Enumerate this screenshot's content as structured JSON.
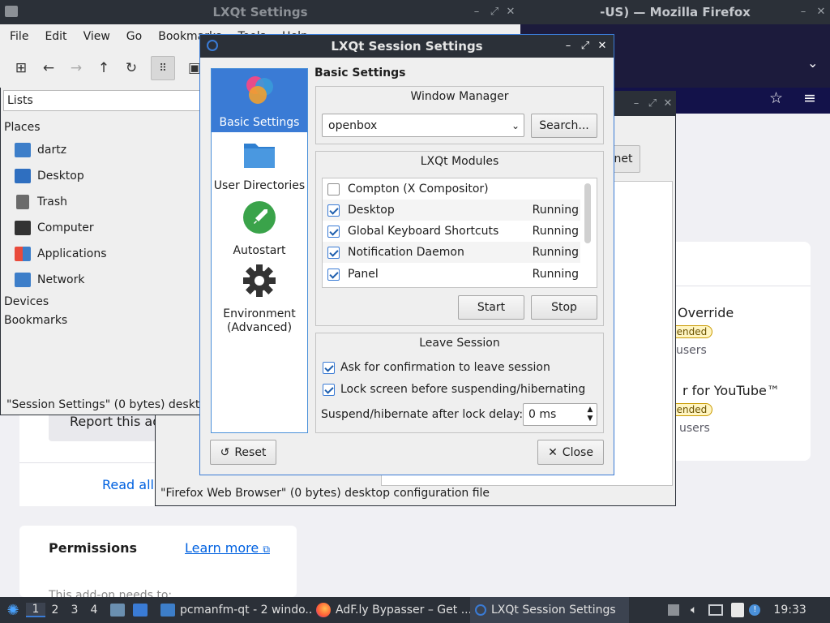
{
  "colors": {
    "accent": "#3a7bd5",
    "titlebar": "#2b3038",
    "window_bg": "#efefef"
  },
  "firefox": {
    "title": "-US) — Mozilla Firefox",
    "content": {
      "tab_fragment": "net",
      "addon1_name": "Override",
      "addon1_badge": "nended",
      "addon1_users": "users",
      "addon2_name": "r for YouTube™",
      "addon2_badge": "nended",
      "addon2_users": "users",
      "report_button": "Report this ad",
      "read_all": "Read all",
      "permissions_title": "Permissions",
      "learn_more": "Learn more",
      "addon_needs": "This add-on needs to:"
    },
    "dialog_status": "\"Firefox Web Browser\" (0 bytes) desktop configuration file"
  },
  "filemanager": {
    "title": "LXQt Settings",
    "menu": [
      "File",
      "Edit",
      "View",
      "Go",
      "Bookmarks",
      "Tools",
      "Help"
    ],
    "sidebar_mode": "Lists",
    "places_header": "Places",
    "places": [
      "dartz",
      "Desktop",
      "Trash",
      "Computer",
      "Applications",
      "Network"
    ],
    "devices_header": "Devices",
    "bookmarks_header": "Bookmarks",
    "status": "\"Session Settings\" (0 bytes) desktop configuration file"
  },
  "dialog": {
    "title": "LXQt Session Settings",
    "nav": [
      {
        "label": "Basic Settings",
        "icon": "lxqt-logo-icon"
      },
      {
        "label": "User Directories",
        "icon": "folder-icon"
      },
      {
        "label": "Autostart",
        "icon": "rocket-icon"
      },
      {
        "label": "Environment (Advanced)",
        "icon": "gear-icon"
      }
    ],
    "section_title": "Basic Settings",
    "window_manager": {
      "title": "Window Manager",
      "value": "openbox",
      "search_label": "Search..."
    },
    "modules": {
      "title": "LXQt Modules",
      "items": [
        {
          "name": "Compton (X Compositor)",
          "checked": false,
          "status": ""
        },
        {
          "name": "Desktop",
          "checked": true,
          "status": "Running"
        },
        {
          "name": "Global Keyboard Shortcuts",
          "checked": true,
          "status": "Running"
        },
        {
          "name": "Notification Daemon",
          "checked": true,
          "status": "Running"
        },
        {
          "name": "Panel",
          "checked": true,
          "status": "Running"
        }
      ],
      "start_label": "Start",
      "stop_label": "Stop"
    },
    "leave_session": {
      "title": "Leave Session",
      "confirm_label": "Ask for confirmation to leave session",
      "confirm_checked": true,
      "lock_label": "Lock screen before suspending/hibernating",
      "lock_checked": true,
      "delay_label": "Suspend/hibernate after lock delay:",
      "delay_value": "0 ms"
    },
    "reset_label": "Reset",
    "close_label": "Close"
  },
  "taskbar": {
    "workspaces": [
      "1",
      "2",
      "3",
      "4"
    ],
    "tasks": [
      {
        "label": "pcmanfm-qt - 2 windo..."
      },
      {
        "label": "AdF.ly Bypasser – Get ..."
      },
      {
        "label": "LXQt Session Settings"
      }
    ],
    "clock": "19:33"
  }
}
